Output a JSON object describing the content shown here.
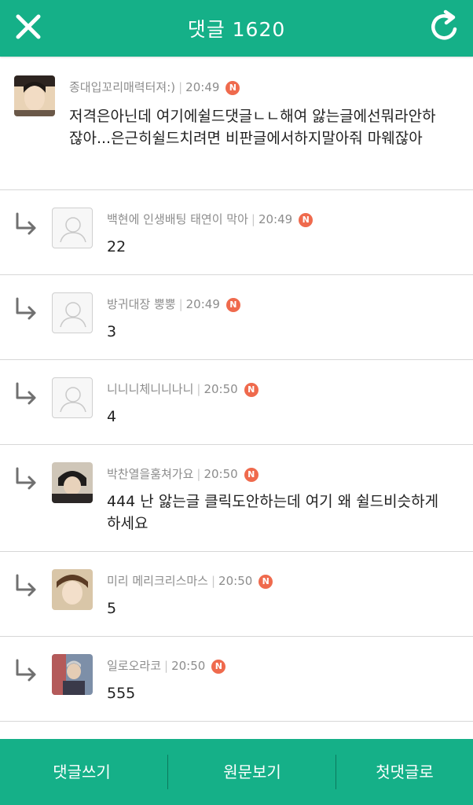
{
  "header": {
    "title": "댓글 1620"
  },
  "comments": [
    {
      "nickname": "종대입꼬리매력터져:)",
      "time": "20:49",
      "badge": "N",
      "text": "저격은아닌데 여기에쉴드댓글ㄴㄴ해여 앓는글에선뭐라안하잖아...은근히쉴드치려면 비판글에서하지말아줘 마웨잖아"
    },
    {
      "nickname": "백현에 인생배팅 태연이 막아",
      "time": "20:49",
      "badge": "N",
      "text": "22"
    },
    {
      "nickname": "방귀대장 뿡뿡",
      "time": "20:49",
      "badge": "N",
      "text": "3"
    },
    {
      "nickname": "니니니체니니나니",
      "time": "20:50",
      "badge": "N",
      "text": "4"
    },
    {
      "nickname": "박찬열을훔쳐가요",
      "time": "20:50",
      "badge": "N",
      "text": "444 난 앓는글 클릭도안하는데 여기 왜 쉴드비슷하게 하세요"
    },
    {
      "nickname": "미리 메리크리스마스",
      "time": "20:50",
      "badge": "N",
      "text": "5"
    },
    {
      "nickname": "일로오라코",
      "time": "20:50",
      "badge": "N",
      "text": "555"
    }
  ],
  "footer": {
    "write": "댓글쓰기",
    "original": "원문보기",
    "first": "첫댓글로"
  },
  "colors": {
    "accent": "#15b088",
    "badge": "#ef6a4d"
  }
}
